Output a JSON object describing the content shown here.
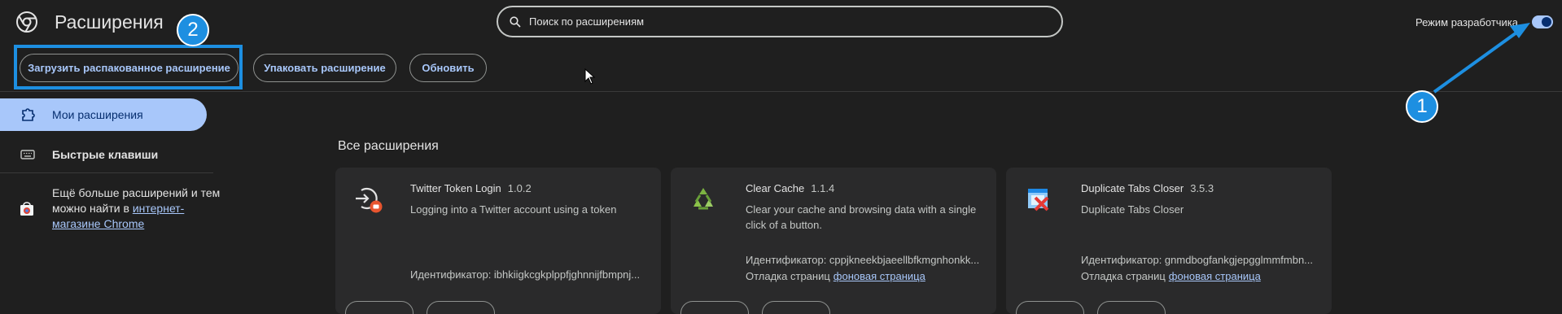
{
  "header": {
    "title": "Расширения",
    "search_placeholder": "Поиск по расширениям",
    "dev_mode_label": "Режим разработчика",
    "dev_mode_on": true
  },
  "toolbar": {
    "load_unpacked": "Загрузить распакованное расширение",
    "pack": "Упаковать расширение",
    "update": "Обновить"
  },
  "sidebar": {
    "items": [
      {
        "label": "Мои расширения",
        "icon": "puzzle-icon",
        "active": true
      },
      {
        "label": "Быстрые клавиши",
        "icon": "keyboard-icon",
        "active": false
      }
    ],
    "promo_text": "Ещё больше расширений и тем можно найти в",
    "promo_link": "интернет-магазине Chrome"
  },
  "main": {
    "section_title": "Все расширения",
    "cards": [
      {
        "name": "Twitter Token Login",
        "version": "1.0.2",
        "description": "Logging into a Twitter account using a token",
        "id": "Идентификатор: ibhkiigkcgkplppfjghnnijfbmpnj...",
        "inspect_label": "",
        "inspect_link": ""
      },
      {
        "name": "Clear Cache",
        "version": "1.1.4",
        "description": "Clear your cache and browsing data with a single click of a button.",
        "id": "Идентификатор: cppjkneekbjaeellbfkmgnhonkk...",
        "inspect_label": "Отладка страниц",
        "inspect_link": "фоновая страница"
      },
      {
        "name": "Duplicate Tabs Closer",
        "version": "3.5.3",
        "description": "Duplicate Tabs Closer",
        "id": "Идентификатор: gnmdbogfankgjepgglmmfmbn...",
        "inspect_label": "Отладка страниц",
        "inspect_link": "фоновая страница"
      }
    ]
  },
  "annotations": {
    "marker_1": "1",
    "marker_2": "2",
    "color": "#1d8fe1"
  },
  "colors": {
    "background": "#1f1f1f",
    "accent": "#a8c7fa",
    "card": "#2a2a2b"
  }
}
